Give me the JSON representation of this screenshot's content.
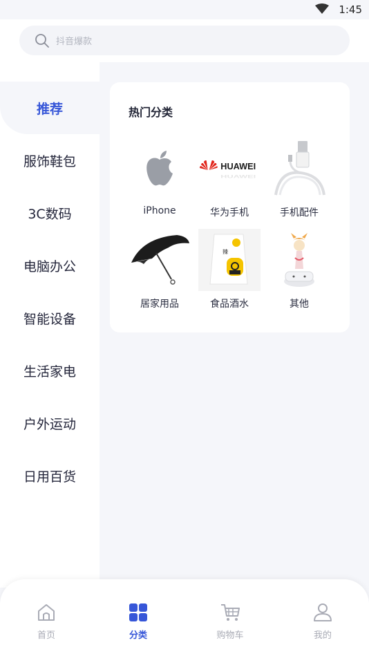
{
  "status_bar": {
    "time": "1:45"
  },
  "search": {
    "placeholder": "抖音爆款"
  },
  "sidebar": {
    "items": [
      {
        "label": "推荐",
        "active": true
      },
      {
        "label": "服饰鞋包"
      },
      {
        "label": "3C数码"
      },
      {
        "label": "电脑办公"
      },
      {
        "label": "智能设备"
      },
      {
        "label": "生活家电"
      },
      {
        "label": "户外运动"
      },
      {
        "label": "日用百货"
      }
    ]
  },
  "main": {
    "section_title": "热门分类",
    "categories": [
      {
        "label": "iPhone",
        "icon": "apple-logo-icon"
      },
      {
        "label": "华为手机",
        "icon": "huawei-logo-icon",
        "brand_text": "HUAWEI"
      },
      {
        "label": "手机配件",
        "icon": "usb-cable-icon"
      },
      {
        "label": "居家用品",
        "icon": "umbrella-icon"
      },
      {
        "label": "食品酒水",
        "icon": "snack-bag-icon"
      },
      {
        "label": "其他",
        "icon": "figurine-icon"
      }
    ]
  },
  "bottom_nav": {
    "items": [
      {
        "label": "首页",
        "icon": "home-icon"
      },
      {
        "label": "分类",
        "icon": "grid-icon",
        "active": true
      },
      {
        "label": "购物车",
        "icon": "cart-icon"
      },
      {
        "label": "我的",
        "icon": "user-icon"
      }
    ]
  },
  "colors": {
    "accent": "#3656d8",
    "background": "#f5f6fa",
    "inactive": "#a9abb5"
  }
}
